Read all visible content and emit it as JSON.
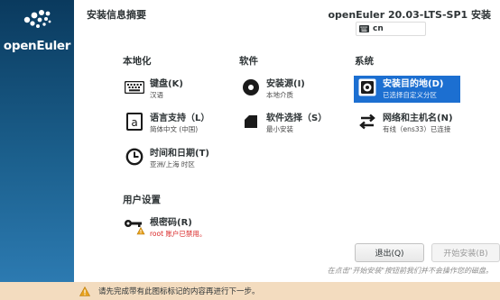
{
  "brand": {
    "name": "openEuler"
  },
  "header": {
    "title": "安装信息摘要",
    "product": "openEuler 20.03-LTS-SP1 安装",
    "keyboard_layout": "cn"
  },
  "sections": {
    "localization": "本地化",
    "software": "软件",
    "system": "系统",
    "user_settings": "用户设置"
  },
  "spokes": {
    "keyboard": {
      "title": "键盘(K)",
      "status": "汉语"
    },
    "language": {
      "title": "语言支持（L）",
      "status": "简体中文 (中国)"
    },
    "datetime": {
      "title": "时间和日期(T)",
      "status": "亚洲/上海 时区"
    },
    "source": {
      "title": "安装源(I)",
      "status": "本地介质"
    },
    "software": {
      "title": "软件选择（S）",
      "status": "最小安装"
    },
    "destination": {
      "title": "安装目的地(D)",
      "status": "已选择自定义分区"
    },
    "network": {
      "title": "网络和主机名(N)",
      "status": "有线（ens33）已连接"
    },
    "root": {
      "title": "根密码(R)",
      "status": "root 账户已禁用。"
    }
  },
  "buttons": {
    "quit": "退出(Q)",
    "begin": "开始安装(B)"
  },
  "hint": "在点击\"开始安装\"按钮前我们并不会操作您的磁盘。",
  "warning": "请先完成带有此图标标记的内容再进行下一步。",
  "colors": {
    "sidebar": "#1b5f8c",
    "selected": "#1c6fd1",
    "warning_bar": "#f3dcbf",
    "warning_text": "#d92424"
  }
}
